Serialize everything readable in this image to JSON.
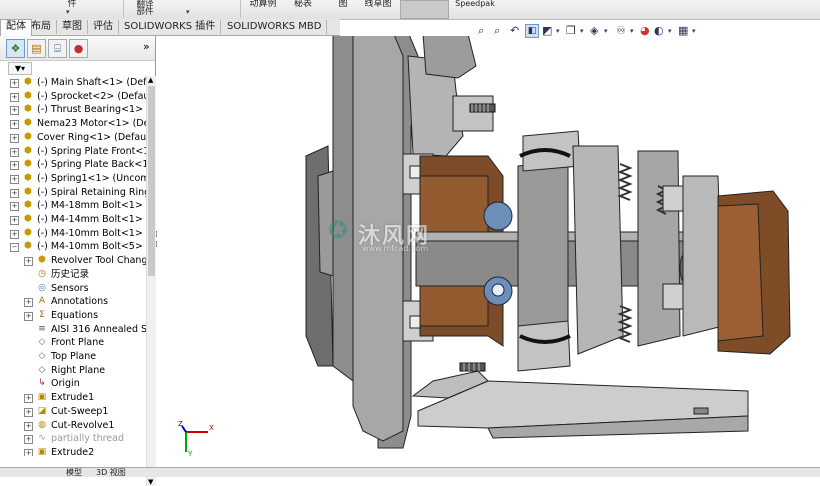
{
  "ribbon": {
    "items": [
      "件",
      "翻译\n部件",
      "动算例",
      "秘表",
      "图",
      "线草图",
      "Speedpak"
    ]
  },
  "tabs": [
    "配体",
    "布局",
    "草图",
    "评估",
    "SOLIDWORKS 插件",
    "SOLIDWORKS MBD"
  ],
  "active_tab": "配体",
  "panel": {
    "more": "»",
    "filter_icon": "filter-icon"
  },
  "tree": [
    {
      "label": "(-) Main Shaft<1> (Defa",
      "icon": "part-icon",
      "expander": "+"
    },
    {
      "label": "(-) Sprocket<2> (Default",
      "icon": "part-icon",
      "expander": "+"
    },
    {
      "label": "(-) Thrust Bearing<1> (D",
      "icon": "part-icon",
      "expander": "+"
    },
    {
      "label": "Nema23 Motor<1> (De",
      "icon": "assembly-icon",
      "expander": "+"
    },
    {
      "label": "Cover Ring<1> (Default",
      "icon": "part-icon",
      "expander": "+"
    },
    {
      "label": "(-) Spring Plate Front<1",
      "icon": "part-icon",
      "expander": "+"
    },
    {
      "label": "(-) Spring Plate Back<1>",
      "icon": "part-icon",
      "expander": "+"
    },
    {
      "label": "(-) Spring1<1> (Uncomp",
      "icon": "part-icon",
      "expander": "+"
    },
    {
      "label": "(-) Spiral Retaining Ring",
      "icon": "part-icon",
      "expander": "+"
    },
    {
      "label": "(-) M4-18mm Bolt<1> (!",
      "icon": "part-icon",
      "expander": "+"
    },
    {
      "label": "(-) M4-14mm Bolt<1> (!",
      "icon": "part-icon",
      "expander": "+"
    },
    {
      "label": "(-) M4-10mm Bolt<1> (!",
      "icon": "part-icon",
      "expander": "+"
    },
    {
      "label": "(-) M4-10mm Bolt<5> (!",
      "icon": "part-icon",
      "expander": "−"
    },
    {
      "label": "Revolver Tool Chang",
      "icon": "part-icon",
      "expander": "+",
      "indent": 1
    },
    {
      "label": "历史记录",
      "icon": "history-icon",
      "expander": "",
      "indent": 1
    },
    {
      "label": "Sensors",
      "icon": "sensor-icon",
      "expander": "",
      "indent": 1
    },
    {
      "label": "Annotations",
      "icon": "annotation-icon",
      "expander": "+",
      "indent": 1
    },
    {
      "label": "Equations",
      "icon": "equation-icon",
      "expander": "+",
      "indent": 1
    },
    {
      "label": "AISI 316 Annealed St",
      "icon": "material-icon",
      "expander": "",
      "indent": 1
    },
    {
      "label": "Front Plane",
      "icon": "plane-icon",
      "expander": "",
      "indent": 1
    },
    {
      "label": "Top Plane",
      "icon": "plane-icon",
      "expander": "",
      "indent": 1
    },
    {
      "label": "Right Plane",
      "icon": "plane-icon",
      "expander": "",
      "indent": 1
    },
    {
      "label": "Origin",
      "icon": "origin-icon",
      "expander": "",
      "indent": 1
    },
    {
      "label": "Extrude1",
      "icon": "extrude-icon",
      "expander": "+",
      "indent": 1
    },
    {
      "label": "Cut-Sweep1",
      "icon": "sweep-icon",
      "expander": "+",
      "indent": 1
    },
    {
      "label": "Cut-Revolve1",
      "icon": "revolve-icon",
      "expander": "+",
      "indent": 1
    },
    {
      "label": "partially thread",
      "icon": "thread-icon",
      "expander": "+",
      "indent": 1,
      "dim": true
    },
    {
      "label": "Extrude2",
      "icon": "extrude-icon",
      "expander": "+",
      "indent": 1
    }
  ],
  "bottom_tabs": [
    "模型",
    "3D 视图"
  ],
  "watermark": {
    "text": "沐风网",
    "url": "www.mfcad.com"
  },
  "triad": {
    "x": "X",
    "y": "Y",
    "z": "Z"
  }
}
